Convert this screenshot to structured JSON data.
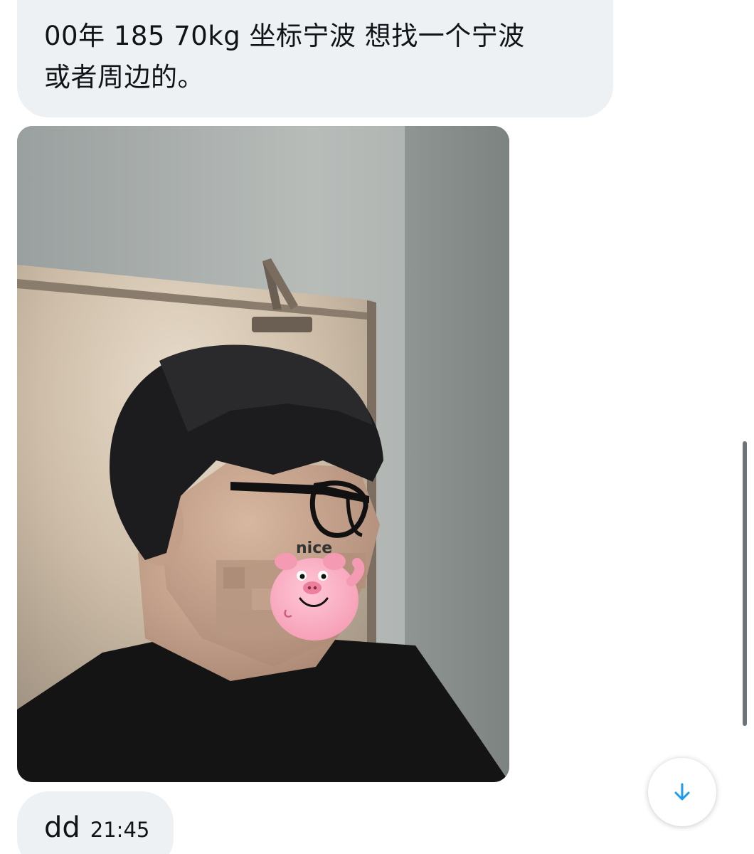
{
  "messages": [
    {
      "type": "text",
      "lines": [
        "00年 185 70kg 坐标宁波 想找一个宁波",
        "或者周边的。"
      ]
    },
    {
      "type": "image",
      "sticker_text": "nice"
    },
    {
      "type": "text",
      "text": "dd",
      "time": "21:45"
    }
  ],
  "scroll_button": {
    "icon": "arrow-down-icon",
    "color": "#1d9bf0"
  },
  "colors": {
    "bubble_bg": "#eef1f3",
    "text": "#0f1419",
    "accent": "#1d9bf0"
  }
}
